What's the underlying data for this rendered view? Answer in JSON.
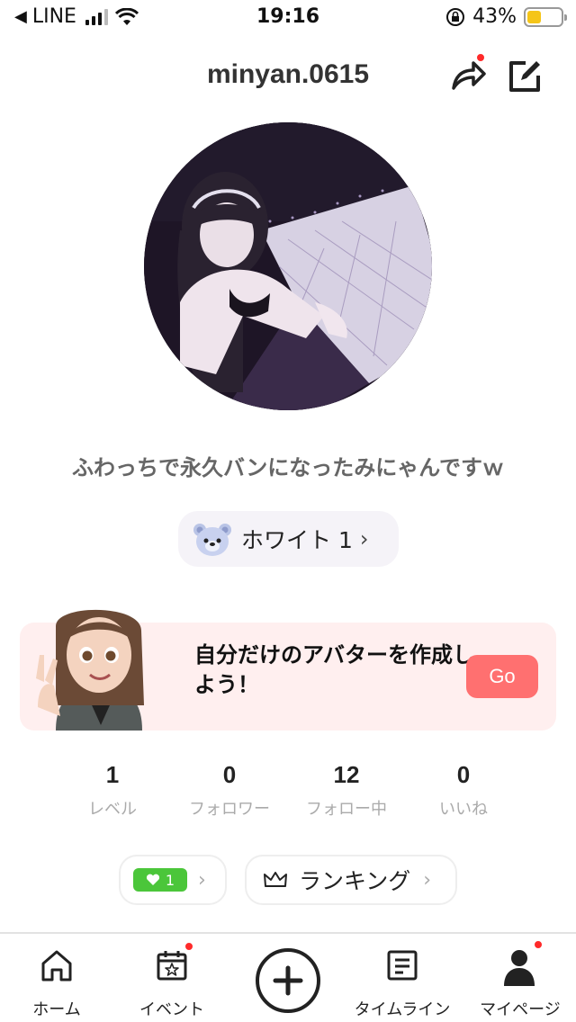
{
  "status_bar": {
    "back_app": "LINE",
    "time": "19:16",
    "battery_percent": "43%",
    "battery_level": 0.43,
    "battery_color": "#f5c518"
  },
  "header": {
    "username": "minyan.0615",
    "share_icon": "share-arrow-icon",
    "edit_icon": "edit-icon",
    "notification_color": "#ff2a2a"
  },
  "profile": {
    "bio": "ふわっちで永久バンになったみにゃんですｗ",
    "rank_chip_label": "ホワイト 1",
    "rank_icon": "bear-icon"
  },
  "banner": {
    "text": "自分だけのアバターを作成しよう！",
    "go_label": "Go",
    "background": "#ffefef",
    "button_color": "#ff7070"
  },
  "stats": [
    {
      "value": "1",
      "label": "レベル"
    },
    {
      "value": "0",
      "label": "フォロワー"
    },
    {
      "value": "12",
      "label": "フォロー中"
    },
    {
      "value": "0",
      "label": "いいね"
    }
  ],
  "pills": {
    "likes_count": "1",
    "likes_color": "#4bc63a",
    "ranking_label": "ランキング"
  },
  "bottom_nav": [
    {
      "label": "ホーム",
      "icon": "home-icon"
    },
    {
      "label": "イベント",
      "icon": "calendar-icon"
    },
    {
      "label": "",
      "icon": "plus-icon"
    },
    {
      "label": "タイムライン",
      "icon": "timeline-icon"
    },
    {
      "label": "マイページ",
      "icon": "person-icon"
    }
  ]
}
